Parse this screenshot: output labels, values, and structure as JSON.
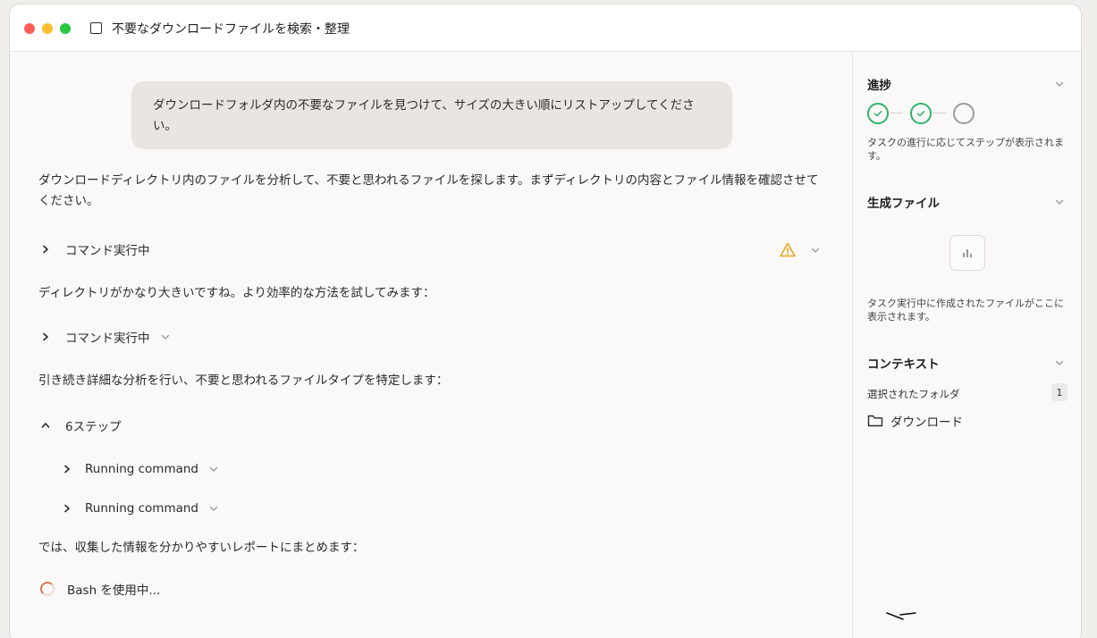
{
  "window": {
    "title": "不要なダウンロードファイルを検索・整理"
  },
  "chat": {
    "user_message": "ダウンロードフォルダ内の不要なファイルを見つけて、サイズの大きい順にリストアップしてください。",
    "assistant_intro": "ダウンロードディレクトリ内のファイルを分析して、不要と思われるファイルを探します。まずディレクトリの内容とファイル情報を確認させてください。",
    "command1_label": "コマンド実行中",
    "assistant_msg2": "ディレクトリがかなり大きいですね。より効率的な方法を試してみます：",
    "command2_label": "コマンド実行中",
    "assistant_msg3": "引き続き詳細な分析を行い、不要と思われるファイルタイプを特定します：",
    "steps_label": "6ステップ",
    "substeps": [
      {
        "label": "Running command"
      },
      {
        "label": "Running command"
      }
    ],
    "assistant_msg4": "では、収集した情報を分かりやすいレポートにまとめます：",
    "status": "Bash を使用中..."
  },
  "sidebar": {
    "progress": {
      "title": "進捗",
      "description": "タスクの進行に応じてステップが表示されます。",
      "steps": [
        "done",
        "done",
        "pending"
      ]
    },
    "files": {
      "title": "生成ファイル",
      "description": "タスク実行中に作成されたファイルがここに表示されます。"
    },
    "context": {
      "title": "コンテキスト",
      "selected_label": "選択されたフォルダ",
      "selected_count": "1",
      "folder_name": "ダウンロード"
    }
  },
  "colors": {
    "accent": "#d97757",
    "success": "#2fb36a",
    "warning": "#e8a317"
  }
}
